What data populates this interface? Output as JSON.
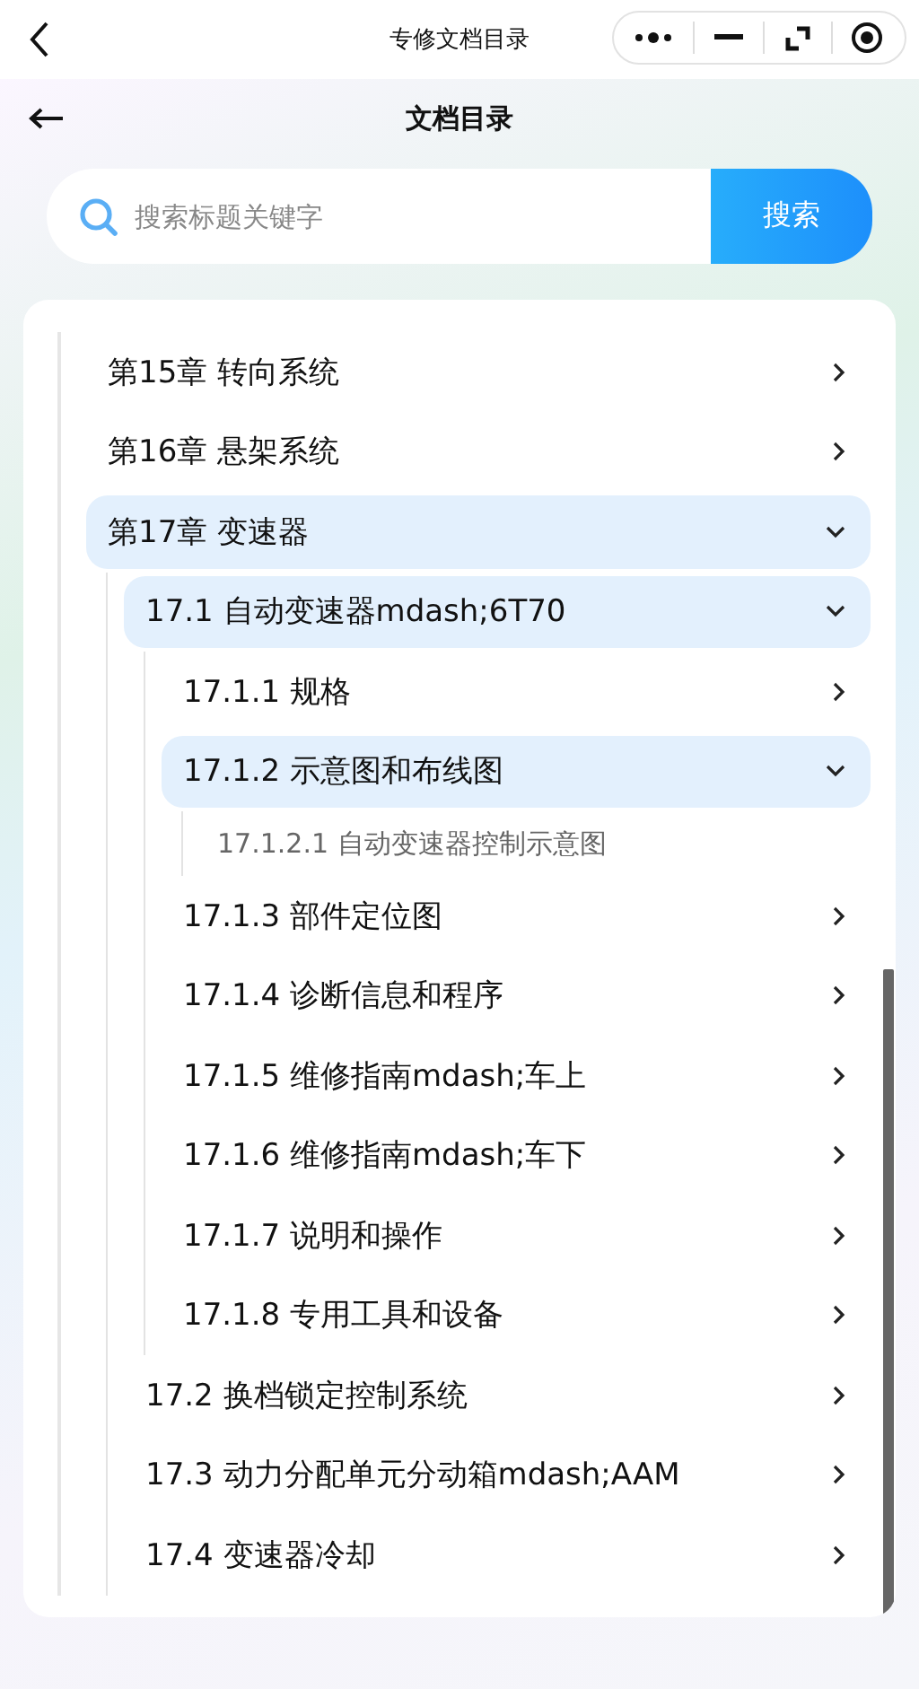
{
  "top_bar": {
    "title": "专修文档目录"
  },
  "header": {
    "title": "文档目录"
  },
  "search": {
    "placeholder": "搜索标题关键字",
    "button": "搜索"
  },
  "tree": [
    {
      "label": "第15章 转向系统",
      "kind": "folder",
      "expanded": false
    },
    {
      "label": "第16章 悬架系统",
      "kind": "folder",
      "expanded": false
    },
    {
      "label": "第17章 变速器",
      "kind": "folder",
      "expanded": true,
      "children": [
        {
          "label": "17.1 自动变速器mdash;6T70",
          "kind": "folder",
          "expanded": true,
          "children": [
            {
              "label": "17.1.1 规格",
              "kind": "folder",
              "expanded": false
            },
            {
              "label": "17.1.2 示意图和布线图",
              "kind": "folder",
              "expanded": true,
              "children": [
                {
                  "label": "17.1.2.1 自动变速器控制示意图",
                  "kind": "doc"
                }
              ]
            },
            {
              "label": "17.1.3 部件定位图",
              "kind": "folder",
              "expanded": false
            },
            {
              "label": "17.1.4 诊断信息和程序",
              "kind": "folder",
              "expanded": false
            },
            {
              "label": "17.1.5 维修指南mdash;车上",
              "kind": "folder",
              "expanded": false
            },
            {
              "label": "17.1.6 维修指南mdash;车下",
              "kind": "folder",
              "expanded": false
            },
            {
              "label": "17.1.7 说明和操作",
              "kind": "folder",
              "expanded": false
            },
            {
              "label": "17.1.8 专用工具和设备",
              "kind": "folder",
              "expanded": false
            }
          ]
        },
        {
          "label": "17.2 换档锁定控制系统",
          "kind": "folder",
          "expanded": false
        },
        {
          "label": "17.3 动力分配单元分动箱mdash;AAM",
          "kind": "folder",
          "expanded": false
        },
        {
          "label": "17.4 变速器冷却",
          "kind": "folder",
          "expanded": false
        }
      ]
    }
  ]
}
